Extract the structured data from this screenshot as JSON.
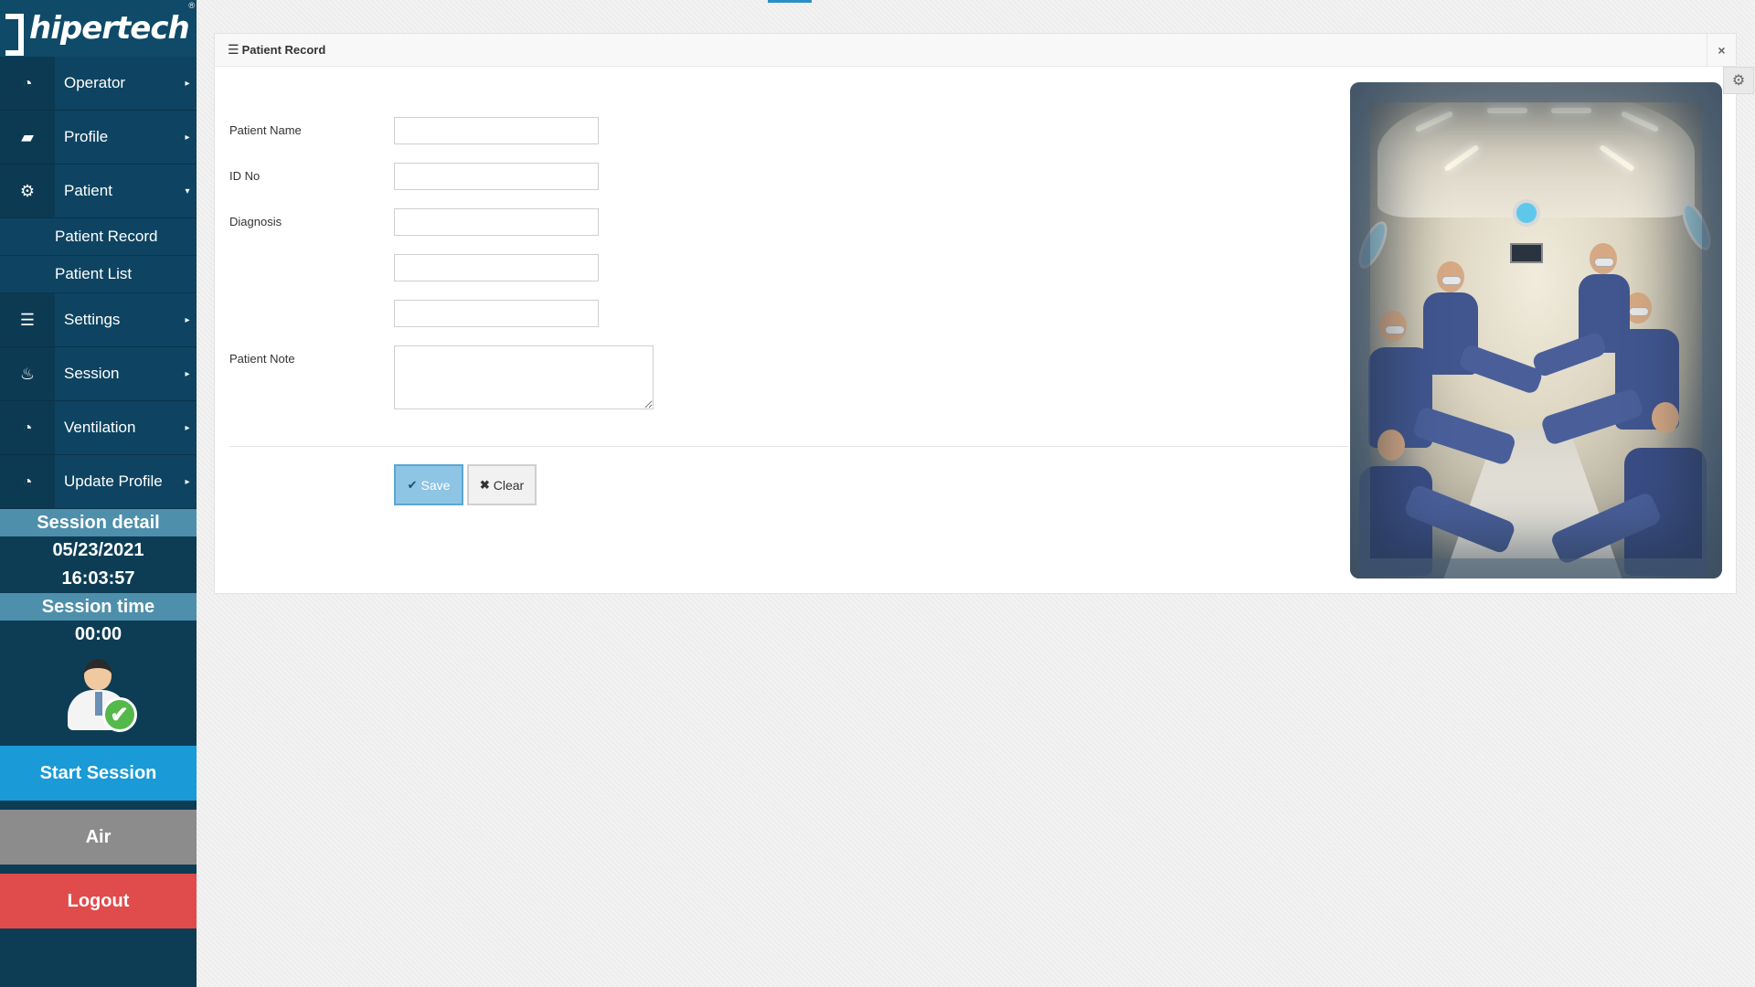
{
  "brand": {
    "name": "hipertech",
    "reg": "®"
  },
  "sidebar": {
    "items": [
      {
        "label": "Operator",
        "icon": "dashboard-icon",
        "arrow": "▸"
      },
      {
        "label": "Profile",
        "icon": "book-icon",
        "arrow": "▸"
      },
      {
        "label": "Patient",
        "icon": "cogs-icon",
        "arrow": "▾"
      },
      {
        "label": "Settings",
        "icon": "list-icon",
        "arrow": "▸"
      },
      {
        "label": "Session",
        "icon": "fire-icon",
        "arrow": "▸"
      },
      {
        "label": "Ventilation",
        "icon": "dashboard-icon",
        "arrow": "▸"
      },
      {
        "label": "Update Profile",
        "icon": "dashboard-icon",
        "arrow": "▸"
      }
    ],
    "patient_sub": [
      {
        "label": "Patient Record"
      },
      {
        "label": "Patient List"
      }
    ],
    "session_detail": {
      "title": "Session detail",
      "date": "05/23/2021",
      "time": "16:03:57"
    },
    "session_time": {
      "title": "Session time",
      "value": "00:00"
    },
    "buttons": {
      "start": "Start Session",
      "air": "Air",
      "logout": "Logout"
    }
  },
  "panel": {
    "title": "Patient Record",
    "close": "×",
    "fields": {
      "patient_name": {
        "label": "Patient Name",
        "value": ""
      },
      "id_no": {
        "label": "ID No",
        "value": ""
      },
      "diagnosis": {
        "label": "Diagnosis",
        "value": ""
      },
      "diagnosis_2": {
        "value": ""
      },
      "diagnosis_3": {
        "value": ""
      },
      "patient_note": {
        "label": "Patient Note",
        "value": ""
      }
    },
    "actions": {
      "save": "Save",
      "clear": "Clear"
    }
  },
  "colors": {
    "sidebar": "#0d3d55",
    "session_header": "#4e8fab",
    "start": "#1a9ad6",
    "air": "#8c8c8c",
    "logout": "#e04b4b",
    "save": "#8ec4e4"
  }
}
